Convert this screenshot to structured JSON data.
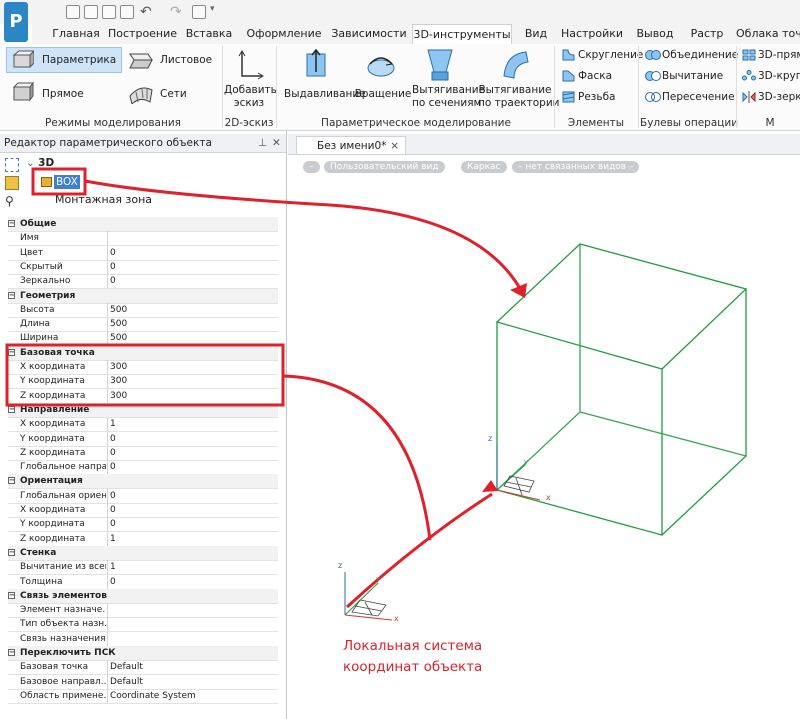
{
  "quick_access": {
    "logo_letter": "P"
  },
  "tabs": [
    "Главная",
    "Построение",
    "Вставка",
    "Оформление",
    "Зависимости",
    "3D-инструменты",
    "Вид",
    "Настройки",
    "Вывод",
    "Растр",
    "Облака точ"
  ],
  "active_tab": "3D-инструменты",
  "ribbon": {
    "modeling_modes": {
      "parametric": "Параметрика",
      "sheet": "Листовое",
      "direct": "Прямое",
      "nets": "Сети",
      "label": "Режимы моделирования"
    },
    "sketch": {
      "add_sketch_line1": "Добавить",
      "add_sketch_line2": "эскиз",
      "label": "2D-эскиз"
    },
    "parametric": {
      "extrude": "Выдавливание",
      "revolve": "Вращение",
      "loft_line1": "Вытягивание",
      "loft_line2": "по сечениям",
      "sweep_line1": "Вытягивание",
      "sweep_line2": "по траектории",
      "label": "Параметрическое моделирование"
    },
    "elements": {
      "fillet": "Скругление",
      "chamfer": "Фаска",
      "thread": "Резьба",
      "label": "Элементы"
    },
    "boolean": {
      "union": "Объединение",
      "subtract": "Вычитание",
      "intersect": "Пересечение",
      "label": "Булевы операции"
    },
    "threed": {
      "rect": "3D-прям",
      "circle": "3D-круго",
      "mirror": "3D-зерка",
      "label": "М"
    }
  },
  "panel": {
    "title": "Редактор параметрического объекта",
    "tree": {
      "root": "3D",
      "selected": "BOX",
      "zone": "Монтажная зона"
    },
    "properties": [
      {
        "type": "header",
        "label": "Общие"
      },
      {
        "label": "Имя",
        "value": ""
      },
      {
        "label": "Цвет",
        "value": "0"
      },
      {
        "label": "Скрытый",
        "value": "0"
      },
      {
        "label": "Зеркально",
        "value": "0"
      },
      {
        "type": "header",
        "label": "Геометрия"
      },
      {
        "label": "Высота",
        "value": "500"
      },
      {
        "label": "Длина",
        "value": "500"
      },
      {
        "label": "Ширина",
        "value": "500"
      },
      {
        "type": "header",
        "label": "Базовая точка"
      },
      {
        "label": "X координата",
        "value": "300"
      },
      {
        "label": "Y координата",
        "value": "300"
      },
      {
        "label": "Z координата",
        "value": "300"
      },
      {
        "type": "header",
        "label": "Направление"
      },
      {
        "label": "X координата",
        "value": "1"
      },
      {
        "label": "Y координата",
        "value": "0"
      },
      {
        "label": "Z координата",
        "value": "0"
      },
      {
        "label": "Глобальное напра...",
        "value": "0"
      },
      {
        "type": "header",
        "label": "Ориентация"
      },
      {
        "label": "Глобальная ориен...",
        "value": "0"
      },
      {
        "label": "X координата",
        "value": "0"
      },
      {
        "label": "Y координата",
        "value": "0"
      },
      {
        "label": "Z координата",
        "value": "1"
      },
      {
        "type": "header",
        "label": "Стенка"
      },
      {
        "label": "Вычитание из всего",
        "value": "1"
      },
      {
        "label": "Толщина",
        "value": "0"
      },
      {
        "type": "header",
        "label": "Связь элементов"
      },
      {
        "label": "Элемент назначе...",
        "value": ""
      },
      {
        "label": "Тип объекта назн...",
        "value": ""
      },
      {
        "label": "Связь назначения",
        "value": ""
      },
      {
        "type": "header",
        "label": "Переключить ПСК"
      },
      {
        "label": "Базовая точка",
        "value": "Default"
      },
      {
        "label": "Базовое направл...",
        "value": "Default"
      },
      {
        "label": "Область примене...",
        "value": "Coordinate System"
      }
    ]
  },
  "document": {
    "tab": "Без имени0*",
    "close": "×",
    "pills": [
      "–",
      "Пользовательский вид",
      "Каркас",
      "– нет связанных видов –"
    ]
  },
  "axes": {
    "x": "x",
    "y": "y",
    "z": "z"
  },
  "annotation": {
    "line1": "Локальная система",
    "line2": "координат объекта"
  },
  "colors": {
    "accent_red": "#e0202a",
    "box_green": "#1f9e3e",
    "logo_blue": "#2b86c5"
  }
}
